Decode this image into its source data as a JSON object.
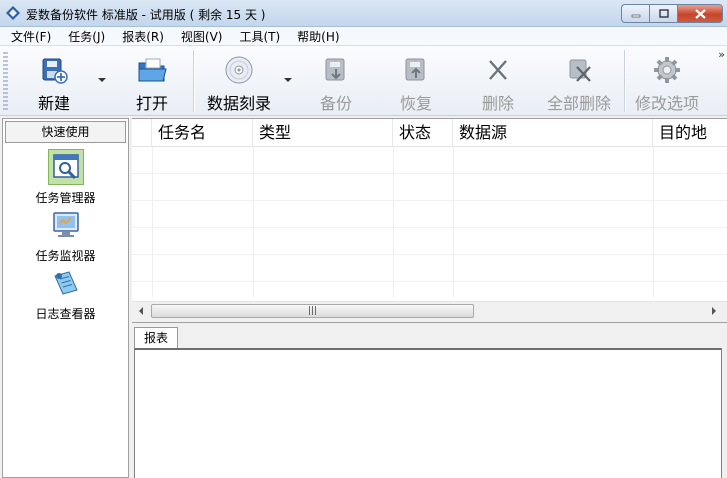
{
  "window": {
    "title": "爱数备份软件 标准版 - 试用版 ( 剩余 15 天 )",
    "icon": "app-diamond-icon"
  },
  "menu": [
    {
      "label": "文件(F)"
    },
    {
      "label": "任务(J)"
    },
    {
      "label": "报表(R)"
    },
    {
      "label": "视图(V)"
    },
    {
      "label": "工具(T)"
    },
    {
      "label": "帮助(H)"
    }
  ],
  "toolbar": {
    "new": {
      "label": "新建",
      "icon": "new-task-icon",
      "enabled": true
    },
    "open": {
      "label": "打开",
      "icon": "folder-open-icon",
      "enabled": true
    },
    "burn": {
      "label": "数据刻录",
      "icon": "disc-icon",
      "enabled": true
    },
    "backup": {
      "label": "备份",
      "icon": "backup-icon",
      "enabled": false
    },
    "restore": {
      "label": "恢复",
      "icon": "restore-icon",
      "enabled": false
    },
    "delete": {
      "label": "删除",
      "icon": "delete-x-icon",
      "enabled": false
    },
    "delete_all": {
      "label": "全部删除",
      "icon": "delete-all-icon",
      "enabled": false
    },
    "options": {
      "label": "修改选项",
      "icon": "gear-icon",
      "enabled": false
    },
    "overflow": "»"
  },
  "left_panel": {
    "header": "快速使用",
    "items": [
      {
        "label": "任务管理器",
        "icon": "task-manager-icon",
        "selected": true
      },
      {
        "label": "任务监视器",
        "icon": "task-monitor-icon",
        "selected": false
      },
      {
        "label": "日志查看器",
        "icon": "log-viewer-icon",
        "selected": false
      }
    ]
  },
  "task_grid": {
    "columns": [
      "任务名",
      "类型",
      "状态",
      "数据源",
      "目的地"
    ],
    "rows": [],
    "scrollbar_thumb": "|||"
  },
  "report_panel": {
    "tabs": [
      "报表"
    ]
  },
  "colors": {
    "titlebar": "#c3d6ec",
    "close_button": "#c6452a",
    "selection": "#c2e0a8"
  }
}
